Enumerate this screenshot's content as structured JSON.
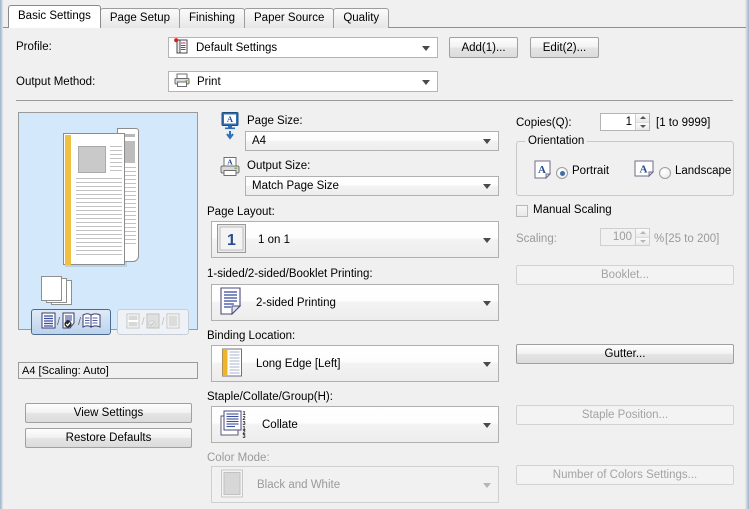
{
  "window": {
    "tabs": [
      {
        "label": "Basic Settings",
        "active": true
      },
      {
        "label": "Page Setup",
        "active": false
      },
      {
        "label": "Finishing",
        "active": false
      },
      {
        "label": "Paper Source",
        "active": false
      },
      {
        "label": "Quality",
        "active": false
      }
    ]
  },
  "profile_section": {
    "profile_label": "Profile:",
    "profile_value": "Default Settings",
    "output_method_label": "Output Method:",
    "output_method_value": "Print",
    "add_button": "Add(1)...",
    "edit_button": "Edit(2)..."
  },
  "preview": {
    "status_text": "A4 [Scaling: Auto]",
    "toggle_group_left": [
      "page-view-icon",
      "two-sided-icon",
      "booklet-icon"
    ],
    "toggle_group_right": [
      "stamp-view-icon",
      "overlay-icon",
      "finishing-icon"
    ]
  },
  "left_buttons": {
    "view_settings": "View Settings",
    "restore_defaults": "Restore Defaults"
  },
  "center": {
    "page_size": {
      "label": "Page Size:",
      "value": "A4",
      "icon": "monitor-a-icon",
      "disabled": false
    },
    "output_size": {
      "label": "Output Size:",
      "value": "Match Page Size",
      "icon": "printer-a-icon",
      "disabled": false
    },
    "page_layout": {
      "label": "Page Layout:",
      "value": "1 on 1",
      "icon": "one-on-one-icon",
      "disabled": false
    },
    "sided_printing": {
      "label": "1-sided/2-sided/Booklet Printing:",
      "value": "2-sided Printing",
      "icon": "two-sided-printing-icon",
      "disabled": false
    },
    "binding_location": {
      "label": "Binding Location:",
      "value": "Long Edge [Left]",
      "icon": "binding-long-edge-icon",
      "disabled": false
    },
    "staple_collate": {
      "label": "Staple/Collate/Group(H):",
      "value": "Collate",
      "icon": "collate-icon",
      "disabled": false
    },
    "color_mode": {
      "label": "Color Mode:",
      "value": "Black and White",
      "icon": "color-swatch-icon",
      "disabled": true
    }
  },
  "right": {
    "copies": {
      "label": "Copies(Q):",
      "value": "1",
      "range_hint": "[1 to 9999]"
    },
    "orientation": {
      "title": "Orientation",
      "portrait_label": "Portrait",
      "landscape_label": "Landscape",
      "selected": "Portrait"
    },
    "manual_scaling": {
      "label": "Manual Scaling",
      "checked": false
    },
    "scaling": {
      "label": "Scaling:",
      "value": "100",
      "unit": "%",
      "range_hint": "[25 to 200]",
      "disabled": true
    },
    "booklet_button": {
      "label": "Booklet...",
      "disabled": true
    },
    "gutter_button": {
      "label": "Gutter...",
      "disabled": false
    },
    "staple_position_button": {
      "label": "Staple Position...",
      "disabled": true
    },
    "number_of_colors_button": {
      "label": "Number of Colors Settings...",
      "disabled": true
    }
  },
  "colors": {
    "preview_bg": "#d4e8fb",
    "accent_blue": "#2a4d8f",
    "spine_yellow": "#f0c040",
    "dialog_bg": "#f0f0f0",
    "disabled_text": "#a3a3a3"
  }
}
